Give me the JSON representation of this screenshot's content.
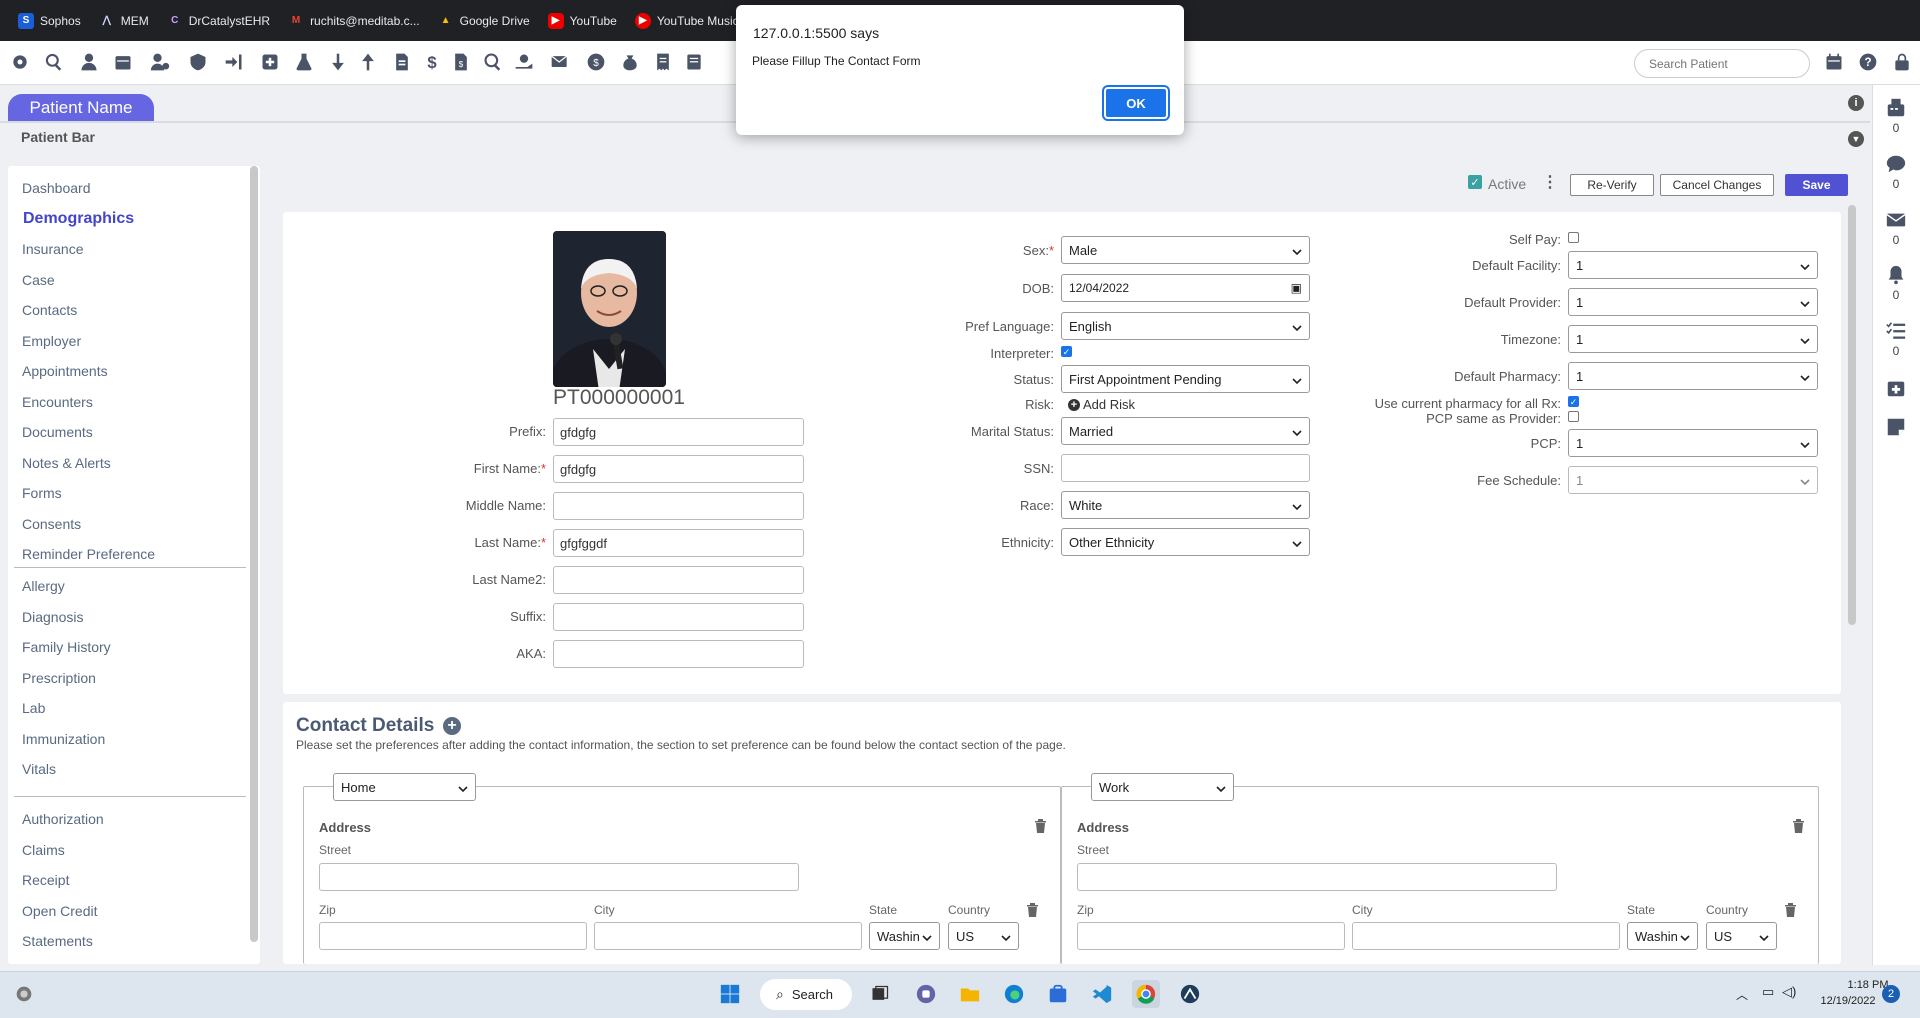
{
  "bookmarks": [
    {
      "label": "Sophos",
      "icon": "sophos-icon",
      "color": "#1a5fd8"
    },
    {
      "label": "MEM",
      "icon": "mem-icon",
      "color": "#202124"
    },
    {
      "label": "DrCatalystEHR",
      "icon": "drcatalyst-icon",
      "color": "#202124"
    },
    {
      "label": "ruchits@meditab.c...",
      "icon": "gmail-icon",
      "color": "#202124"
    },
    {
      "label": "Google Drive",
      "icon": "google-drive-icon",
      "color": "#202124"
    },
    {
      "label": "YouTube",
      "icon": "youtube-icon",
      "color": "#e00"
    },
    {
      "label": "YouTube Music",
      "icon": "youtube-music-icon",
      "color": "#e00"
    }
  ],
  "toolbar": {
    "icons": [
      "settings-icon",
      "search-icon",
      "user-icon",
      "calendar-icon",
      "user-settings-icon",
      "shield-icon",
      "login-icon",
      "medical-add-icon",
      "flask-icon",
      "arrow-down-icon",
      "arrow-up-icon",
      "document-upload-icon",
      "dollar-icon",
      "invoice-icon",
      "search-dollar-icon",
      "hand-money-icon",
      "mail-dollar-icon",
      "coin-icon",
      "money-bag-icon",
      "receipt-icon",
      "ledger-icon"
    ],
    "search_placeholder": "Search Patient",
    "right_icons": [
      "calendar-grid-icon",
      "help-icon",
      "lock-icon"
    ]
  },
  "patient": {
    "tab_label": "Patient Name",
    "bar_label": "Patient Bar",
    "id": "PT000000001"
  },
  "leftnav": {
    "group1": [
      "Dashboard",
      "Demographics",
      "Insurance",
      "Case",
      "Contacts",
      "Employer",
      "Appointments",
      "Encounters",
      "Documents",
      "Notes & Alerts",
      "Forms",
      "Consents",
      "Reminder Preference"
    ],
    "group2": [
      "Allergy",
      "Diagnosis",
      "Family History",
      "Prescription",
      "Lab",
      "Immunization",
      "Vitals"
    ],
    "group3": [
      "Authorization",
      "Claims",
      "Receipt",
      "Open Credit",
      "Statements"
    ],
    "active": "Demographics"
  },
  "rail": {
    "items": [
      {
        "icon": "fax-icon",
        "count": "0"
      },
      {
        "icon": "chat-icon",
        "count": "0"
      },
      {
        "icon": "mail-icon",
        "count": "0"
      },
      {
        "icon": "bell-icon",
        "count": "0"
      },
      {
        "icon": "tasks-icon",
        "count": "0"
      },
      {
        "icon": "calendar-add-icon",
        "count": ""
      },
      {
        "icon": "sticky-note-icon",
        "count": ""
      }
    ]
  },
  "actions": {
    "active_label": "Active",
    "reverify": "Re-Verify",
    "cancel": "Cancel Changes",
    "save": "Save"
  },
  "name_form": {
    "prefix_label": "Prefix:",
    "prefix": "gfdgfg",
    "first_label": "First Name:",
    "first": "gfdgfg",
    "middle_label": "Middle Name:",
    "middle": "",
    "last_label": "Last Name:",
    "last": "gfgfggdf",
    "last2_label": "Last Name2:",
    "last2": "",
    "suffix_label": "Suffix:",
    "suffix": "",
    "aka_label": "AKA:",
    "aka": ""
  },
  "demo_form": {
    "sex_label": "Sex:",
    "sex": "Male",
    "dob_label": "DOB:",
    "dob": "12/04/2022",
    "lang_label": "Pref Language:",
    "lang": "English",
    "interpreter_label": "Interpreter:",
    "status_label": "Status:",
    "status": "First Appointment Pending",
    "risk_label": "Risk:",
    "add_risk": "Add Risk",
    "marital_label": "Marital Status:",
    "marital": "Married",
    "ssn_label": "SSN:",
    "ssn": "",
    "race_label": "Race:",
    "race": "White",
    "ethnicity_label": "Ethnicity:",
    "ethnicity": "Other Ethnicity"
  },
  "provider_form": {
    "selfpay_label": "Self Pay:",
    "facility_label": "Default Facility:",
    "facility": "1",
    "provider_label": "Default Provider:",
    "provider": "1",
    "timezone_label": "Timezone:",
    "timezone": "1",
    "pharmacy_label": "Default Pharmacy:",
    "pharmacy": "1",
    "use_pharmacy_label": "Use current pharmacy for all Rx:",
    "pcp_same_label": "PCP same as Provider:",
    "pcp_label": "PCP:",
    "pcp": "1",
    "fee_label": "Fee Schedule:",
    "fee": "1"
  },
  "contact": {
    "title": "Contact Details",
    "note": "Please set the preferences after adding the contact information, the section to set preference can be found below the contact section of the page.",
    "left": {
      "type": "Home",
      "address": "Address",
      "street": "Street",
      "zip": "Zip",
      "city": "City",
      "state_label": "State",
      "state": "Washin",
      "country_label": "Country",
      "country": "US"
    },
    "right": {
      "type": "Work",
      "address": "Address",
      "street": "Street",
      "zip": "Zip",
      "city": "City",
      "state_label": "State",
      "state": "Washin",
      "country_label": "Country",
      "country": "US"
    }
  },
  "dialog": {
    "title": "127.0.0.1:5500 says",
    "message": "Please Fillup The Contact Form",
    "ok": "OK"
  },
  "taskbar": {
    "search": "Search",
    "time": "1:18 PM",
    "date": "12/19/2022",
    "notifications": "2"
  }
}
